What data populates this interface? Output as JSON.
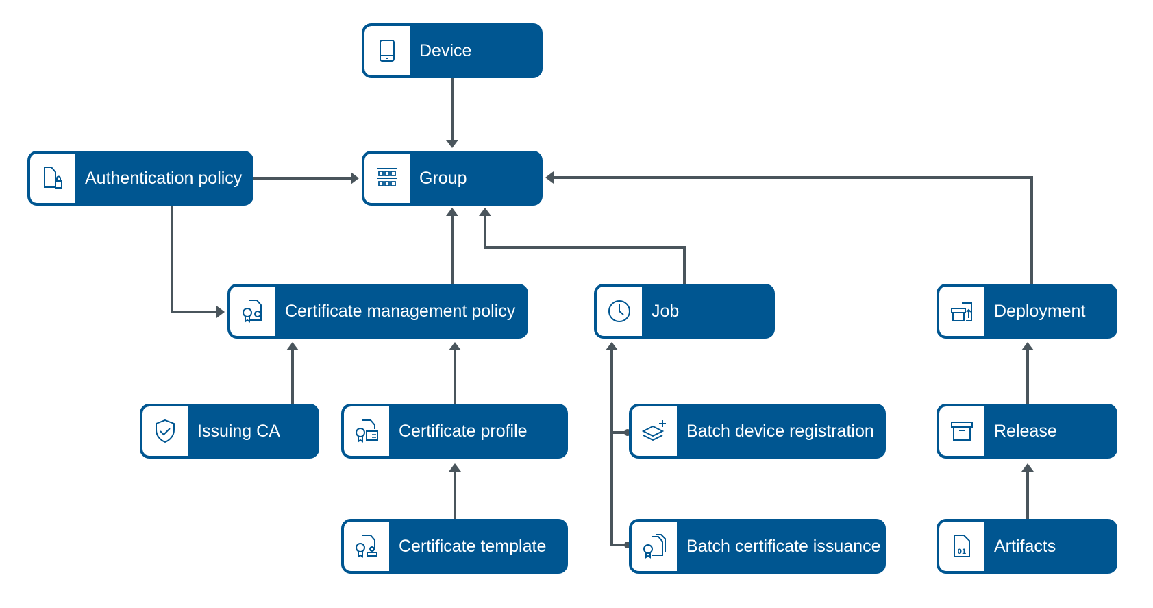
{
  "colors": {
    "node": "#005691",
    "connector": "#4a555c",
    "icon_bg": "#ffffff"
  },
  "nodes": [
    {
      "id": "device",
      "label": "Device",
      "icon": "tablet-icon"
    },
    {
      "id": "group",
      "label": "Group",
      "icon": "grid-icon"
    },
    {
      "id": "auth",
      "label": "Authentication policy",
      "icon": "document-lock-icon"
    },
    {
      "id": "cmp",
      "label": "Certificate management policy",
      "icon": "certificate-settings-icon"
    },
    {
      "id": "job",
      "label": "Job",
      "icon": "clock-icon"
    },
    {
      "id": "deployment",
      "label": "Deployment",
      "icon": "box-upload-icon"
    },
    {
      "id": "issuing",
      "label": "Issuing CA",
      "icon": "shield-check-icon"
    },
    {
      "id": "profile",
      "label": "Certificate profile",
      "icon": "certificate-id-icon"
    },
    {
      "id": "batchdev",
      "label": "Batch device registration",
      "icon": "layers-plus-icon"
    },
    {
      "id": "release",
      "label": "Release",
      "icon": "archive-box-icon"
    },
    {
      "id": "template",
      "label": "Certificate template",
      "icon": "certificate-stamp-icon"
    },
    {
      "id": "batchcert",
      "label": "Batch certificate issuance",
      "icon": "certificate-stack-icon"
    },
    {
      "id": "artifacts",
      "label": "Artifacts",
      "icon": "binary-file-icon"
    }
  ],
  "edges": [
    {
      "from": "device",
      "to": "group"
    },
    {
      "from": "auth",
      "to": "group"
    },
    {
      "from": "auth",
      "to": "cmp"
    },
    {
      "from": "cmp",
      "to": "group"
    },
    {
      "from": "job",
      "to": "group"
    },
    {
      "from": "deployment",
      "to": "group"
    },
    {
      "from": "issuing",
      "to": "cmp"
    },
    {
      "from": "profile",
      "to": "cmp"
    },
    {
      "from": "template",
      "to": "profile"
    },
    {
      "from": "batchdev",
      "to": "job"
    },
    {
      "from": "batchcert",
      "to": "job"
    },
    {
      "from": "release",
      "to": "deployment"
    },
    {
      "from": "artifacts",
      "to": "release"
    }
  ]
}
